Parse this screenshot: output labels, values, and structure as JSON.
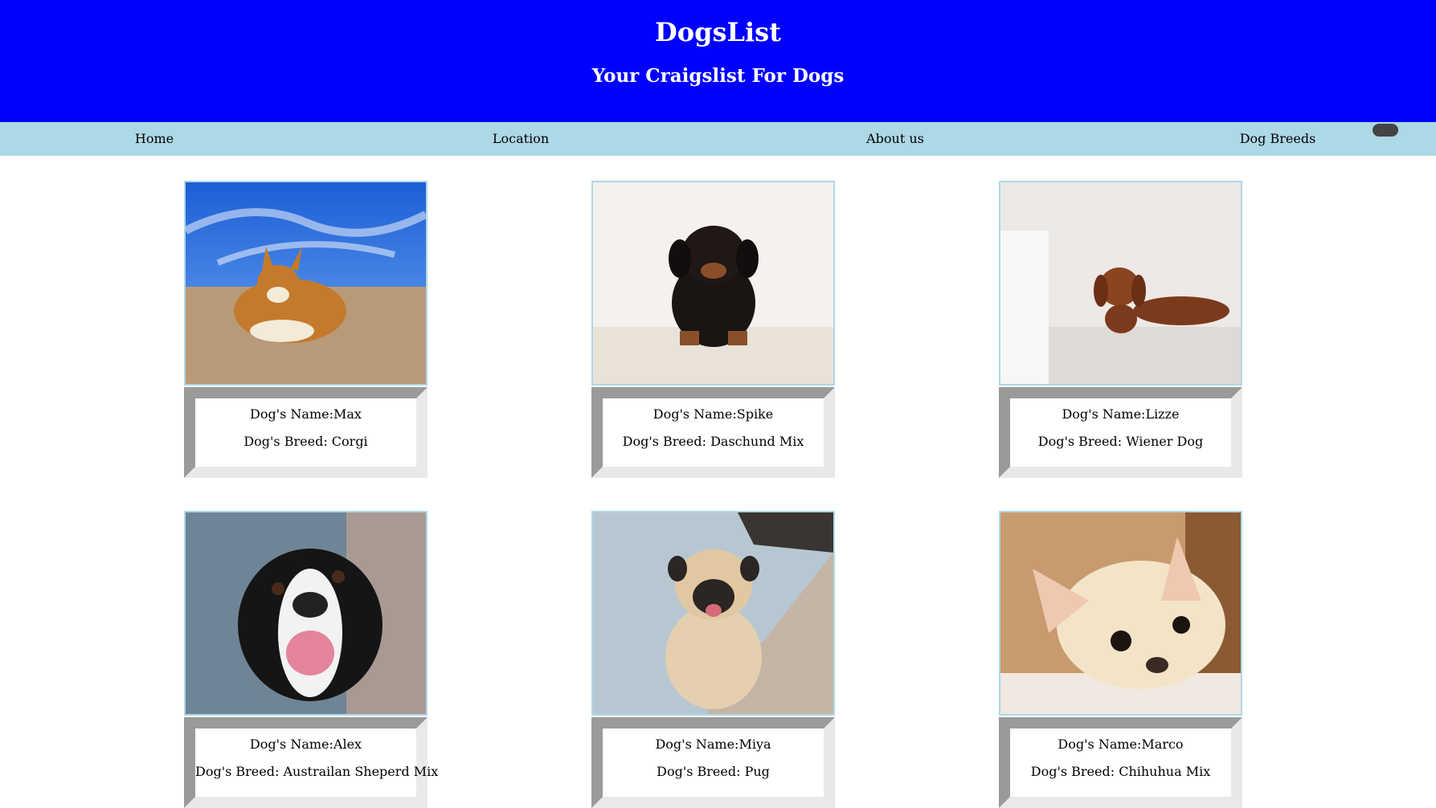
{
  "header": {
    "title": "DogsList",
    "subtitle": "Your Craigslist For Dogs"
  },
  "nav": {
    "items": [
      "Home",
      "Location",
      "About us",
      "Dog Breeds"
    ]
  },
  "cards": [
    {
      "name": "Dog's Name:Max",
      "breed": "Dog's Breed: Corgi"
    },
    {
      "name": "Dog's Name:Spike",
      "breed": "Dog's Breed: Daschund Mix"
    },
    {
      "name": "Dog's Name:Lizze",
      "breed": "Dog's Breed: Wiener Dog"
    },
    {
      "name": "Dog's Name:Alex",
      "breed": "Dog's Breed: Austrailan Sheperd Mix"
    },
    {
      "name": "Dog's Name:Miya",
      "breed": "Dog's Breed: Pug"
    },
    {
      "name": "Dog's Name:Marco",
      "breed": "Dog's Breed: Chihuhua Mix"
    }
  ],
  "colors": {
    "header_bg": "#0000ff",
    "nav_bg": "#add8e6",
    "photo_border": "#add8e6"
  }
}
